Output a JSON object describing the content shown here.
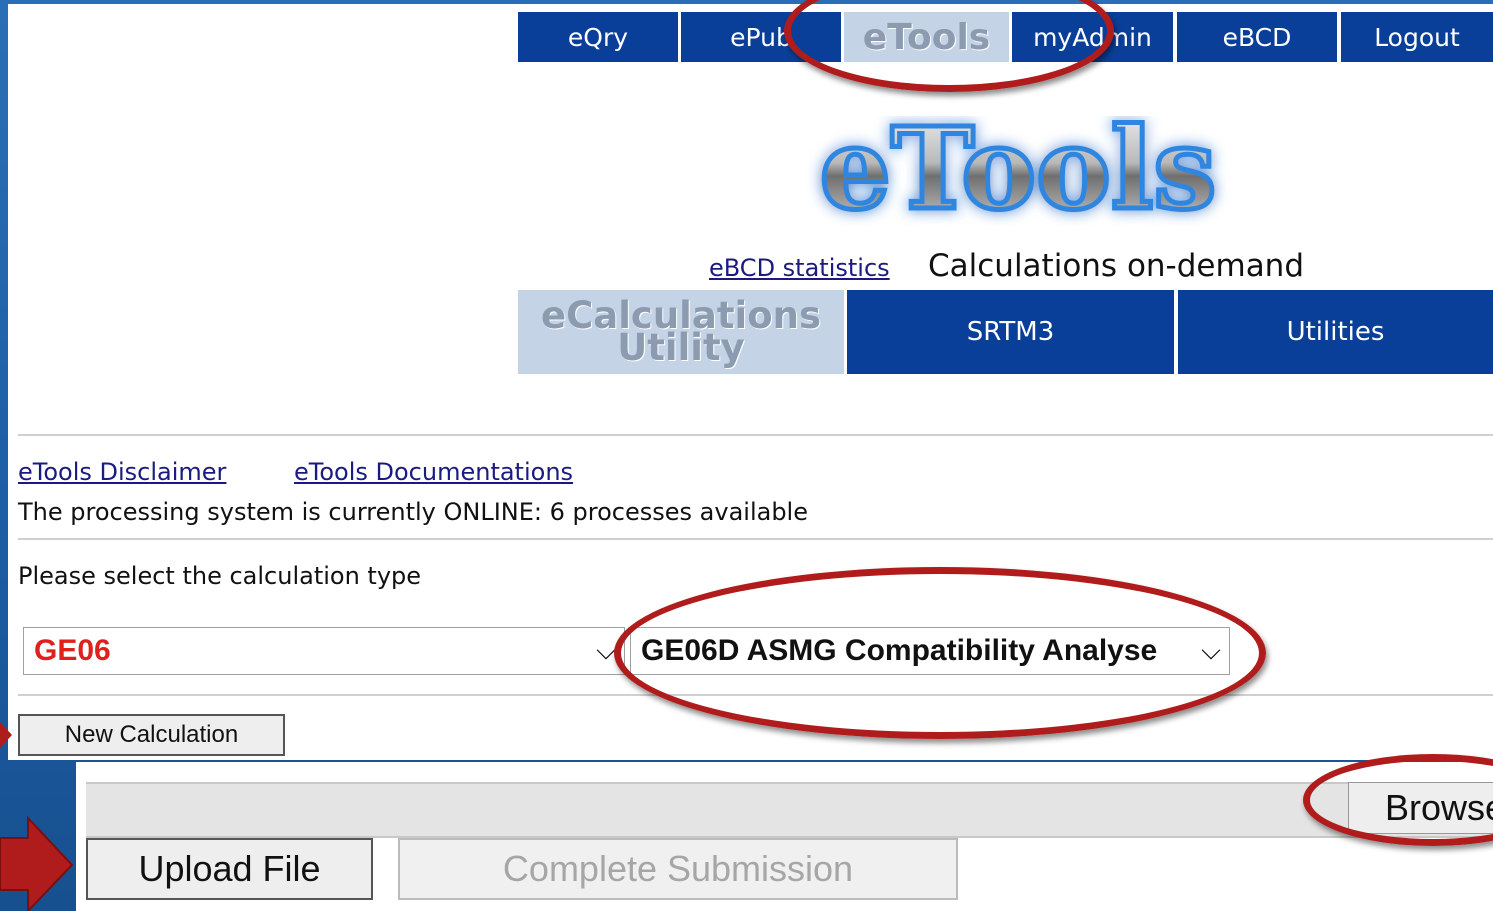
{
  "nav": {
    "tabs": [
      {
        "label": "eQry"
      },
      {
        "label": "ePub"
      },
      {
        "label": "eTools"
      },
      {
        "label": "myAdmin"
      },
      {
        "label": "eBCD"
      },
      {
        "label": "Logout"
      }
    ],
    "active": "eTools"
  },
  "logo": {
    "text": "eTools"
  },
  "header": {
    "stats_link": "eBCD statistics",
    "heading": "Calculations on-demand"
  },
  "subtabs": {
    "ecalc_line1": "eCalculations",
    "ecalc_line2": "Utility",
    "srtm3": "SRTM3",
    "utilities": "Utilities"
  },
  "links": {
    "disclaimer": "eTools Disclaimer",
    "documentations": "eTools Documentations"
  },
  "status": "The processing system is currently ONLINE: 6 processes available",
  "form": {
    "prompt": "Please select the calculation type",
    "type_select": "GE06",
    "subtype_select": "GE06D ASMG Compatibility Analyse",
    "new_calc": "New Calculation"
  },
  "upload": {
    "browse": "Browse",
    "upload_file": "Upload File",
    "complete": "Complete Submission"
  },
  "colors": {
    "nav_blue": "#0a3f99",
    "active_tab": "#c5d3e6",
    "annotation_red": "#b01c1c",
    "select_red": "#e0201c"
  }
}
